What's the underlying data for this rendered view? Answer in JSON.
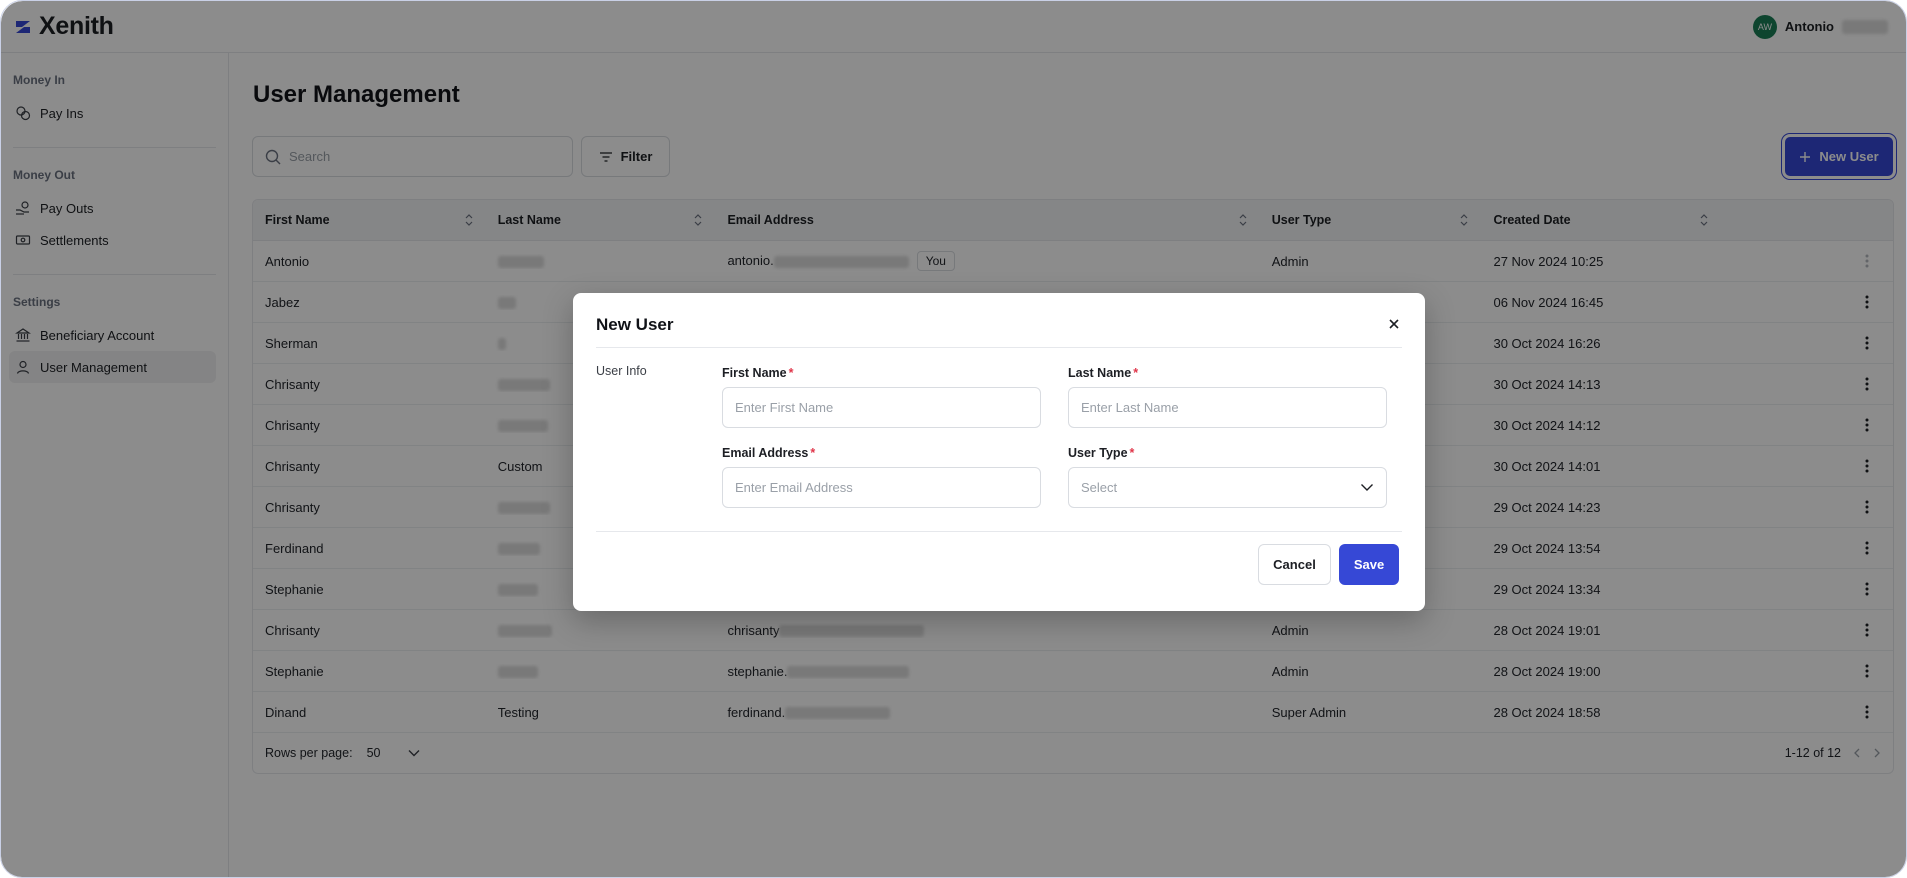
{
  "app": {
    "name": "Xenith"
  },
  "user": {
    "initials": "AW",
    "name": "Antonio"
  },
  "sidebar": {
    "sections": [
      {
        "title": "Money In",
        "items": [
          {
            "label": "Pay Ins",
            "icon": "coins-icon"
          }
        ]
      },
      {
        "title": "Money Out",
        "items": [
          {
            "label": "Pay Outs",
            "icon": "hand-coins-icon"
          },
          {
            "label": "Settlements",
            "icon": "banknote-icon"
          }
        ]
      },
      {
        "title": "Settings",
        "items": [
          {
            "label": "Beneficiary Account",
            "icon": "bank-icon"
          },
          {
            "label": "User Management",
            "icon": "user-icon",
            "active": true
          }
        ]
      }
    ]
  },
  "page": {
    "title": "User Management",
    "search_placeholder": "Search",
    "filter_label": "Filter",
    "new_user_label": "New User"
  },
  "table": {
    "columns": [
      "First Name",
      "Last Name",
      "Email Address",
      "User Type",
      "Created Date"
    ],
    "rows": [
      {
        "first": "Antonio",
        "last": "",
        "email": "antonio.",
        "you": "You",
        "type": "Admin",
        "created": "27 Nov 2024 10:25"
      },
      {
        "first": "Jabez",
        "last": "",
        "email": "",
        "type": "",
        "created": "06 Nov 2024 16:45"
      },
      {
        "first": "Sherman",
        "last": "",
        "email": "",
        "type": "",
        "created": "30 Oct 2024 16:26"
      },
      {
        "first": "Chrisanty",
        "last": "",
        "email": "",
        "type": "",
        "created": "30 Oct 2024 14:13"
      },
      {
        "first": "Chrisanty",
        "last": "",
        "email": "",
        "type": "",
        "created": "30 Oct 2024 14:12"
      },
      {
        "first": "Chrisanty",
        "last": "Custom",
        "email": "",
        "type": "",
        "created": "30 Oct 2024 14:01"
      },
      {
        "first": "Chrisanty",
        "last": "",
        "email": "",
        "type": "",
        "created": "29 Oct 2024 14:23"
      },
      {
        "first": "Ferdinand",
        "last": "",
        "email": "",
        "type": "",
        "created": "29 Oct 2024 13:54"
      },
      {
        "first": "Stephanie",
        "last": "",
        "email": "",
        "type": "",
        "created": "29 Oct 2024 13:34"
      },
      {
        "first": "Chrisanty",
        "last": "",
        "email": "chrisanty",
        "type": "Admin",
        "created": "28 Oct 2024 19:01"
      },
      {
        "first": "Stephanie",
        "last": "",
        "email": "stephanie.",
        "type": "Admin",
        "created": "28 Oct 2024 19:00"
      },
      {
        "first": "Dinand",
        "last": "Testing",
        "email": "ferdinand.",
        "type": "Super Admin",
        "created": "28 Oct 2024 18:58"
      }
    ],
    "footer": {
      "rows_per_page_label": "Rows per page:",
      "rows_per_page_value": "50",
      "range": "1-12 of 12"
    }
  },
  "modal": {
    "title": "New User",
    "section_label": "User Info",
    "fields": {
      "first_name": {
        "label": "First Name",
        "placeholder": "Enter First Name"
      },
      "last_name": {
        "label": "Last Name",
        "placeholder": "Enter Last Name"
      },
      "email": {
        "label": "Email Address",
        "placeholder": "Enter Email Address"
      },
      "user_type": {
        "label": "User Type",
        "placeholder": "Select"
      }
    },
    "required_mark": "*",
    "cancel_label": "Cancel",
    "save_label": "Save"
  },
  "colors": {
    "primary": "#3648d6",
    "avatar": "#1a7f56",
    "required": "#e0364a"
  }
}
